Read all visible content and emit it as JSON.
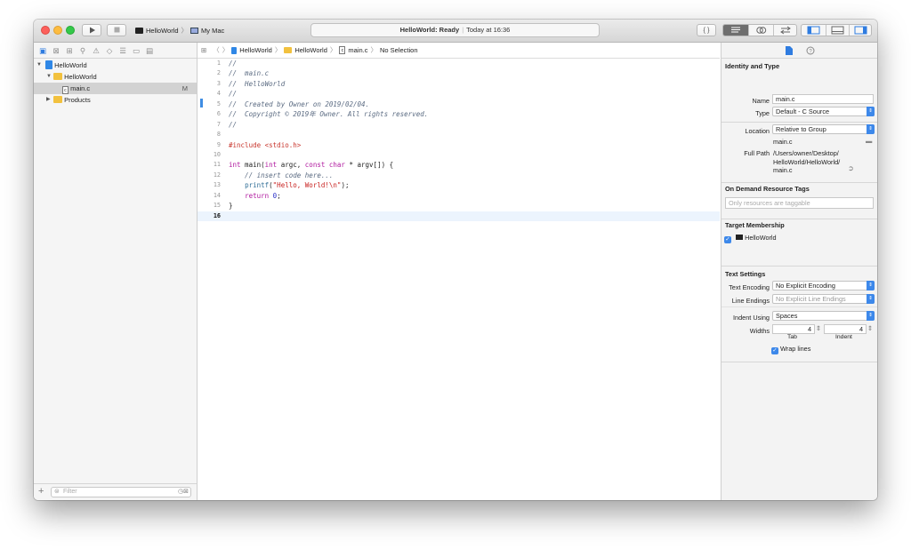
{
  "toolbar": {
    "scheme": "HelloWorld",
    "destination": "My Mac",
    "status": "HelloWorld: Ready",
    "time": "Today at 16:36",
    "editor_brackets": "{ }"
  },
  "navigator": {
    "project": "HelloWorld",
    "group": "HelloWorld",
    "file": "main.c",
    "file_badge": "M",
    "products": "Products",
    "filter_placeholder": "Filter"
  },
  "jumpbar": {
    "items": [
      "HelloWorld",
      "HelloWorld",
      "main.c",
      "No Selection"
    ]
  },
  "code_lines": [
    {
      "n": "1",
      "t": "//"
    },
    {
      "n": "2",
      "t": "//  main.c"
    },
    {
      "n": "3",
      "t": "//  HelloWorld"
    },
    {
      "n": "4",
      "t": "//"
    },
    {
      "n": "5",
      "t": "//  Created by Owner on 2019/02/04."
    },
    {
      "n": "6",
      "t": "//  Copyright © 2019年 Owner. All rights reserved."
    },
    {
      "n": "7",
      "t": "//"
    },
    {
      "n": "8",
      "t": ""
    },
    {
      "n": "9",
      "t": "#include <stdio.h>"
    },
    {
      "n": "10",
      "t": ""
    },
    {
      "n": "11",
      "t": "int main(int argc, const char * argv[]) {"
    },
    {
      "n": "12",
      "t": "    // insert code here..."
    },
    {
      "n": "13",
      "t": "    printf(\"Hello, World!\\n\");"
    },
    {
      "n": "14",
      "t": "    return 0;"
    },
    {
      "n": "15",
      "t": "}"
    },
    {
      "n": "16",
      "t": ""
    }
  ],
  "inspector": {
    "identity_title": "Identity and Type",
    "name_label": "Name",
    "name_value": "main.c",
    "type_label": "Type",
    "type_value": "Default - C Source",
    "location_label": "Location",
    "location_value": "Relative to Group",
    "location_file": "main.c",
    "full_path_label": "Full Path",
    "full_path_value": "/Users/owner/Desktop/ HelloWorld/HelloWorld/ main.c",
    "odr_title": "On Demand Resource Tags",
    "odr_placeholder": "Only resources are taggable",
    "target_title": "Target Membership",
    "target_name": "HelloWorld",
    "text_title": "Text Settings",
    "encoding_label": "Text Encoding",
    "encoding_value": "No Explicit Encoding",
    "endings_label": "Line Endings",
    "endings_value": "No Explicit Line Endings",
    "indent_label": "Indent Using",
    "indent_value": "Spaces",
    "widths_label": "Widths",
    "tab_value": "4",
    "indent_width_value": "4",
    "tab_label": "Tab",
    "indent_sub_label": "Indent",
    "wrap_label": "Wrap lines"
  },
  "colors": {
    "accent": "#3d88ea",
    "close": "#fc605c",
    "minimize": "#fdbc40",
    "zoom": "#34c84a"
  }
}
